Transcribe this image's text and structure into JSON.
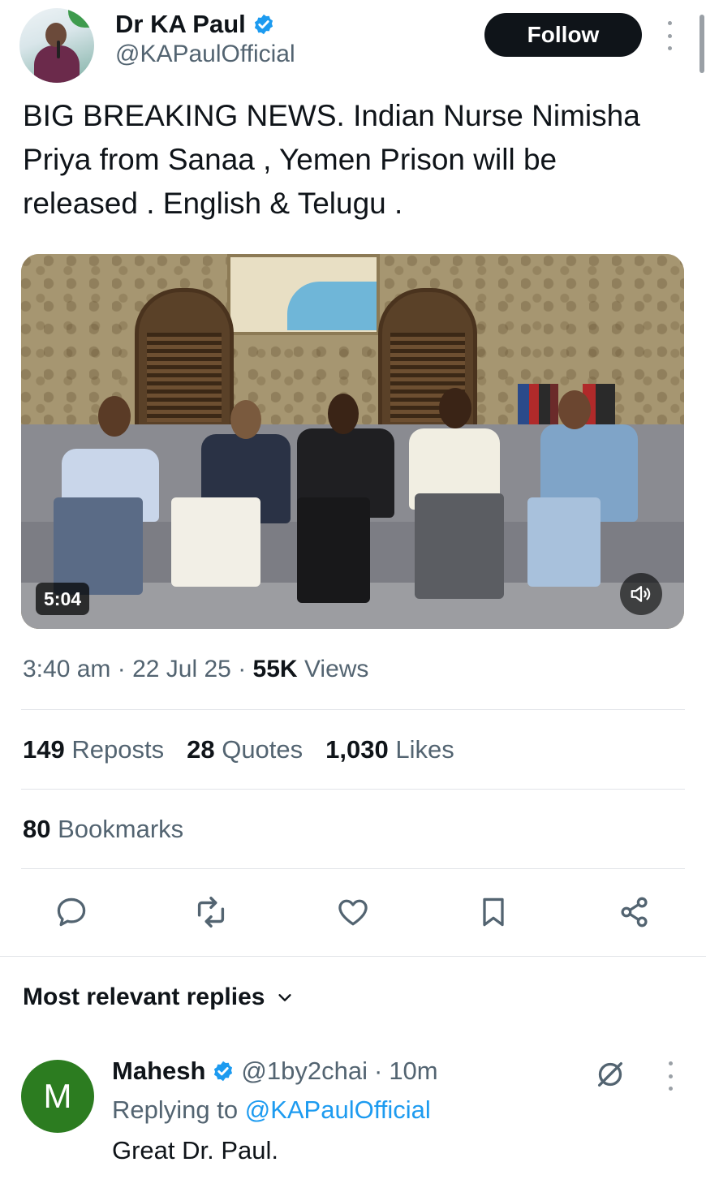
{
  "post": {
    "author_name": "Dr KA Paul",
    "author_handle": "@KAPaulOfficial",
    "follow_label": "Follow",
    "text": "BIG BREAKING NEWS. Indian Nurse Nimisha Priya from Sanaa , Yemen Prison will be released . English & Telugu .",
    "video_duration": "5:04",
    "time": "3:40 am",
    "date": "22 Jul 25",
    "separator": "·",
    "views_count": "55K",
    "views_label": "Views"
  },
  "stats": {
    "reposts_count": "149",
    "reposts_label": "Reposts",
    "quotes_count": "28",
    "quotes_label": "Quotes",
    "likes_count": "1,030",
    "likes_label": "Likes",
    "bookmarks_count": "80",
    "bookmarks_label": "Bookmarks"
  },
  "replies": {
    "sort_label": "Most relevant replies",
    "items": [
      {
        "avatar_letter": "M",
        "name": "Mahesh",
        "handle": "@1by2chai",
        "separator": "·",
        "time": "10m",
        "replying_prefix": "Replying to",
        "replying_handle": "@KAPaulOfficial",
        "text": "Great Dr. Paul."
      }
    ]
  },
  "colors": {
    "verified": "#1d9bf0",
    "link": "#1d9bf0",
    "reply_avatar": "#2c7c20",
    "follow_button": "#0f1419"
  },
  "icons": [
    "verified-badge-icon",
    "more-options-icon",
    "volume-icon",
    "reply-icon",
    "repost-icon",
    "like-icon",
    "bookmark-icon",
    "share-icon",
    "chevron-down-icon",
    "grok-icon"
  ]
}
